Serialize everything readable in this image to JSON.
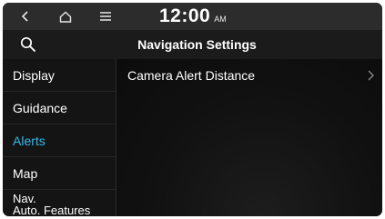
{
  "statusbar": {
    "back_icon": "back-chevron-icon",
    "home_icon": "home-icon",
    "menu_icon": "menu-icon",
    "time": "12:00",
    "ampm": "AM"
  },
  "header": {
    "search_icon": "search-icon",
    "title": "Navigation Settings"
  },
  "sidebar": {
    "items": [
      {
        "label": "Display",
        "active": false
      },
      {
        "label": "Guidance",
        "active": false
      },
      {
        "label": "Alerts",
        "active": true
      },
      {
        "label": "Map",
        "active": false
      },
      {
        "label_line1": "Nav.",
        "label_line2": "Auto. Features",
        "active": false
      }
    ]
  },
  "content": {
    "rows": [
      {
        "label": "Camera Alert Distance",
        "icon": "chevron-right-icon"
      }
    ]
  },
  "colors": {
    "accent": "#38b7e8",
    "background": "#0c0c0c",
    "statusbar": "#2c2c2c",
    "header": "#1b1b1b"
  }
}
